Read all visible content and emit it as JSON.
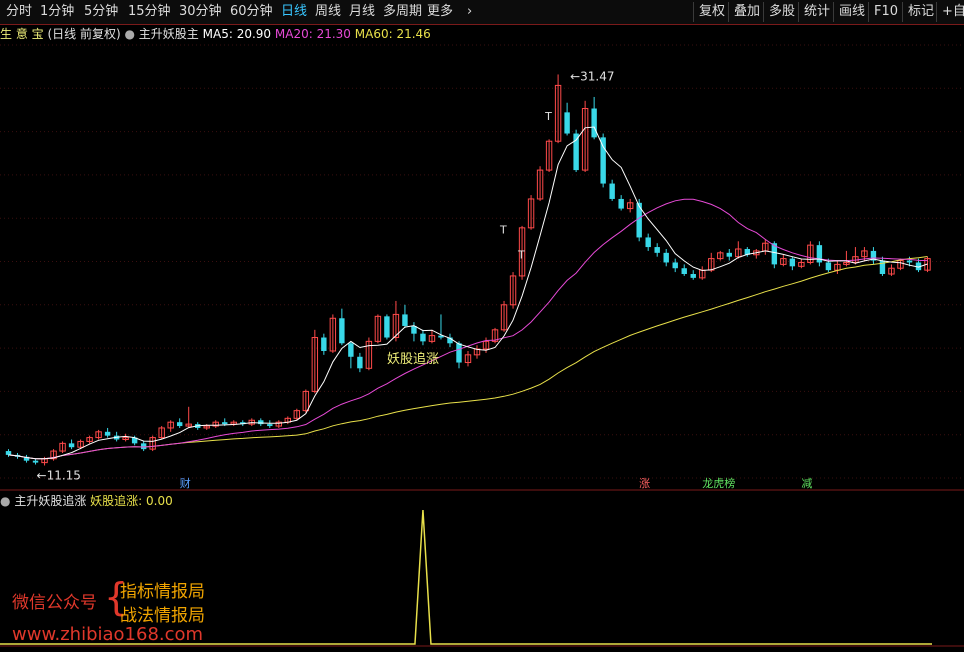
{
  "toolbar": {
    "periods": [
      "分时",
      "1分钟",
      "5分钟",
      "15分钟",
      "30分钟",
      "60分钟",
      "日线",
      "周线",
      "月线",
      "多周期",
      "更多"
    ],
    "active_period": "日线",
    "right_buttons": [
      "复权",
      "叠加",
      "多股",
      "统计",
      "画线",
      "F10",
      "标记",
      "+自选"
    ]
  },
  "legend": {
    "stock": "生 意 宝",
    "adjust": "(日线 前复权)",
    "indicator": "主升妖股主",
    "ma5": "MA5: 20.90",
    "ma20": "MA20: 21.30",
    "ma60": "MA60: 21.46"
  },
  "annotations": {
    "high": "31.47",
    "low": "11.15",
    "signal_label": "妖股追涨",
    "t_markers": [
      "T",
      "T",
      "T"
    ],
    "event_tags": [
      "财",
      "涨",
      "龙虎榜",
      "减"
    ]
  },
  "indicator_legend": {
    "name": "主升妖股追涨",
    "value": "妖股追涨: 0.00"
  },
  "watermark": {
    "wechat": "微信公众号",
    "brace": "{",
    "line1": "指标情报局",
    "line2": "战法情报局",
    "site": "www.zhibiao168.com"
  },
  "colors": {
    "up": "#ff4a4a",
    "down": "#39d8e8",
    "ma5": "#ffffff",
    "ma20": "#e64ad6",
    "ma60": "#e8e04a",
    "indicator": "#e8e04a",
    "active_tab": "#39c6ff"
  },
  "chart_data": {
    "type": "candlestick",
    "series": [
      {
        "name": "MA5",
        "values": []
      },
      {
        "name": "MA20",
        "values": []
      },
      {
        "name": "MA60",
        "values": []
      }
    ],
    "candles": [
      [
        11.9,
        11.7,
        12.0,
        11.6
      ],
      [
        11.7,
        11.6,
        11.8,
        11.5
      ],
      [
        11.6,
        11.4,
        11.7,
        11.3
      ],
      [
        11.4,
        11.3,
        11.5,
        11.2
      ],
      [
        11.3,
        11.5,
        11.6,
        11.15
      ],
      [
        11.5,
        11.9,
        12.0,
        11.4
      ],
      [
        11.9,
        12.3,
        12.4,
        11.8
      ],
      [
        12.3,
        12.1,
        12.5,
        12.0
      ],
      [
        12.1,
        12.4,
        12.5,
        12.0
      ],
      [
        12.4,
        12.6,
        12.7,
        12.3
      ],
      [
        12.6,
        12.9,
        13.0,
        12.5
      ],
      [
        12.9,
        12.7,
        13.1,
        12.6
      ],
      [
        12.7,
        12.5,
        12.9,
        12.4
      ],
      [
        12.5,
        12.6,
        12.8,
        12.4
      ],
      [
        12.6,
        12.3,
        12.7,
        12.2
      ],
      [
        12.3,
        12.0,
        12.4,
        11.9
      ],
      [
        12.0,
        12.6,
        12.7,
        11.9
      ],
      [
        12.6,
        13.1,
        13.2,
        12.5
      ],
      [
        13.1,
        13.4,
        13.5,
        12.9
      ],
      [
        13.4,
        13.2,
        13.6,
        13.1
      ],
      [
        13.2,
        13.3,
        14.2,
        13.1
      ],
      [
        13.3,
        13.1,
        13.4,
        13.0
      ],
      [
        13.1,
        13.2,
        13.3,
        13.0
      ],
      [
        13.2,
        13.4,
        13.5,
        13.1
      ],
      [
        13.4,
        13.3,
        13.6,
        13.2
      ],
      [
        13.3,
        13.4,
        13.5,
        13.2
      ],
      [
        13.4,
        13.3,
        13.5,
        13.2
      ],
      [
        13.3,
        13.5,
        13.6,
        13.2
      ],
      [
        13.5,
        13.3,
        13.6,
        13.2
      ],
      [
        13.3,
        13.2,
        13.5,
        13.1
      ],
      [
        13.2,
        13.4,
        13.5,
        13.1
      ],
      [
        13.4,
        13.6,
        13.7,
        13.3
      ],
      [
        13.6,
        14.0,
        14.1,
        13.5
      ],
      [
        14.0,
        15.0,
        15.1,
        13.9
      ],
      [
        15.0,
        17.8,
        18.2,
        14.9
      ],
      [
        17.8,
        17.1,
        18.0,
        16.9
      ],
      [
        17.1,
        18.8,
        19.0,
        17.0
      ],
      [
        18.8,
        17.5,
        19.3,
        17.4
      ],
      [
        17.5,
        16.8,
        17.6,
        16.2
      ],
      [
        16.8,
        16.2,
        17.0,
        16.0
      ],
      [
        16.2,
        17.6,
        17.8,
        16.1
      ],
      [
        17.6,
        18.9,
        19.0,
        17.5
      ],
      [
        18.9,
        17.8,
        19.0,
        17.7
      ],
      [
        17.8,
        19.0,
        19.7,
        17.6
      ],
      [
        19.0,
        18.4,
        19.5,
        18.3
      ],
      [
        18.4,
        18.0,
        18.6,
        17.6
      ],
      [
        18.0,
        17.6,
        18.2,
        17.4
      ],
      [
        17.6,
        17.9,
        18.2,
        17.5
      ],
      [
        17.9,
        17.8,
        19.0,
        17.7
      ],
      [
        17.8,
        17.5,
        18.0,
        17.3
      ],
      [
        17.5,
        16.5,
        17.6,
        16.2
      ],
      [
        16.5,
        16.9,
        17.1,
        16.3
      ],
      [
        16.9,
        17.2,
        17.4,
        16.7
      ],
      [
        17.2,
        17.6,
        17.8,
        17.0
      ],
      [
        17.6,
        18.2,
        18.3,
        17.5
      ],
      [
        18.2,
        19.5,
        19.7,
        18.1
      ],
      [
        19.5,
        21.0,
        21.2,
        19.3
      ],
      [
        21.0,
        23.5,
        23.6,
        20.8
      ],
      [
        23.5,
        25.0,
        25.2,
        23.4
      ],
      [
        25.0,
        26.5,
        26.7,
        24.9
      ],
      [
        26.5,
        28.0,
        28.1,
        26.4
      ],
      [
        28.0,
        30.9,
        31.47,
        27.9
      ],
      [
        29.5,
        28.4,
        30.0,
        28.3
      ],
      [
        28.4,
        26.5,
        28.6,
        26.4
      ],
      [
        26.5,
        29.7,
        30.1,
        26.4
      ],
      [
        29.7,
        28.2,
        30.3,
        28.1
      ],
      [
        28.2,
        25.8,
        28.4,
        25.6
      ],
      [
        25.8,
        25.0,
        26.0,
        24.9
      ],
      [
        25.0,
        24.5,
        25.2,
        24.4
      ],
      [
        24.5,
        24.8,
        25.0,
        24.3
      ],
      [
        24.8,
        23.0,
        25.0,
        22.8
      ],
      [
        23.0,
        22.5,
        23.2,
        22.3
      ],
      [
        22.5,
        22.2,
        22.7,
        22.0
      ],
      [
        22.2,
        21.7,
        22.4,
        21.5
      ],
      [
        21.7,
        21.4,
        21.9,
        21.2
      ],
      [
        21.4,
        21.1,
        21.6,
        21.0
      ],
      [
        21.1,
        20.9,
        21.3,
        20.8
      ],
      [
        20.9,
        21.3,
        21.5,
        20.8
      ],
      [
        21.3,
        21.9,
        22.2,
        21.2
      ],
      [
        21.9,
        22.2,
        22.3,
        21.8
      ],
      [
        22.2,
        22.0,
        22.4,
        21.8
      ],
      [
        22.0,
        22.4,
        22.8,
        21.9
      ],
      [
        22.4,
        22.1,
        22.5,
        22.0
      ],
      [
        22.1,
        22.3,
        22.4,
        21.9
      ],
      [
        22.3,
        22.7,
        22.9,
        22.1
      ],
      [
        22.7,
        21.6,
        22.8,
        21.4
      ],
      [
        21.6,
        21.9,
        22.1,
        21.5
      ],
      [
        21.9,
        21.5,
        22.0,
        21.3
      ],
      [
        21.5,
        21.7,
        21.9,
        21.4
      ],
      [
        21.7,
        22.6,
        22.8,
        21.6
      ],
      [
        22.6,
        21.7,
        22.8,
        21.5
      ],
      [
        21.7,
        21.3,
        21.9,
        21.2
      ],
      [
        21.3,
        21.6,
        21.8,
        21.1
      ],
      [
        21.6,
        21.7,
        22.3,
        21.5
      ],
      [
        21.7,
        22.0,
        22.5,
        21.6
      ],
      [
        22.0,
        22.3,
        22.5,
        21.8
      ],
      [
        22.3,
        21.8,
        22.5,
        21.6
      ],
      [
        21.8,
        21.1,
        22.0,
        21.0
      ],
      [
        21.1,
        21.4,
        21.6,
        21.0
      ],
      [
        21.4,
        21.8,
        21.9,
        21.3
      ],
      [
        21.8,
        21.7,
        22.0,
        21.5
      ],
      [
        21.7,
        21.3,
        21.9,
        21.2
      ],
      [
        21.3,
        21.9,
        22.0,
        21.2
      ]
    ],
    "indicator_values": "spike of 1 at the 47th candle, 0 elsewhere",
    "ylim": [
      10.5,
      33
    ]
  }
}
